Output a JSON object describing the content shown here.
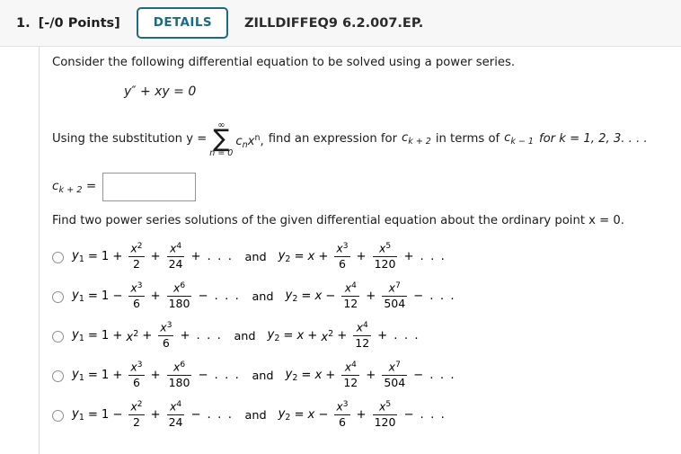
{
  "header": {
    "question_number": "1.",
    "points": "[-/0 Points]",
    "details_label": "DETAILS",
    "question_code": "ZILLDIFFEQ9 6.2.007.EP."
  },
  "body": {
    "intro_text": "Consider the following differential equation to be solved using a power series.",
    "equation": "y″ + xy = 0",
    "substitution": {
      "prefix": "Using the substitution y =",
      "sum_upper": "∞",
      "sum_symbol": "∑",
      "sum_lower": "n = 0",
      "summand_c": "c",
      "summand_c_sub": "n",
      "summand_x": "x",
      "summand_x_sup": "n",
      "comma": ",",
      "mid_text": "find an expression for",
      "target_c": "c",
      "target_sub": "k + 2",
      "in_terms_text": "in terms of",
      "source_c": "c",
      "source_sub": "k − 1",
      "for_text": "for k = 1, 2, 3. . . ."
    },
    "answer": {
      "label_c": "c",
      "label_sub": "k + 2",
      "label_eq": "=",
      "value": "",
      "placeholder": ""
    },
    "find_text": "Find two power series solutions of the given differential equation about the ordinary point x = 0.",
    "and_label": "and",
    "ellipsis": ". . .",
    "options": [
      {
        "y1": {
          "name": "y",
          "sub": "1",
          "eq": "=",
          "first": "1",
          "terms": [
            {
              "op": "+",
              "num_base": "x",
              "num_sup": "2",
              "den": "2"
            },
            {
              "op": "+",
              "num_base": "x",
              "num_sup": "4",
              "den": "24"
            }
          ],
          "tail_op": "+"
        },
        "y2": {
          "name": "y",
          "sub": "2",
          "eq": "=",
          "first": "x",
          "terms": [
            {
              "op": "+",
              "num_base": "x",
              "num_sup": "3",
              "den": "6"
            },
            {
              "op": "+",
              "num_base": "x",
              "num_sup": "5",
              "den": "120"
            }
          ],
          "tail_op": "+"
        }
      },
      {
        "y1": {
          "name": "y",
          "sub": "1",
          "eq": "=",
          "first": "1",
          "terms": [
            {
              "op": "−",
              "num_base": "x",
              "num_sup": "3",
              "den": "6"
            },
            {
              "op": "+",
              "num_base": "x",
              "num_sup": "6",
              "den": "180"
            }
          ],
          "tail_op": "−"
        },
        "y2": {
          "name": "y",
          "sub": "2",
          "eq": "=",
          "first": "x",
          "terms": [
            {
              "op": "−",
              "num_base": "x",
              "num_sup": "4",
              "den": "12"
            },
            {
              "op": "+",
              "num_base": "x",
              "num_sup": "7",
              "den": "504"
            }
          ],
          "tail_op": "−"
        }
      },
      {
        "y1": {
          "name": "y",
          "sub": "1",
          "eq": "=",
          "first": "1",
          "inline": {
            "op": "+",
            "base": "x",
            "sup": "2"
          },
          "terms": [
            {
              "op": "+",
              "num_base": "x",
              "num_sup": "3",
              "den": "6"
            }
          ],
          "tail_op": "+"
        },
        "y2": {
          "name": "y",
          "sub": "2",
          "eq": "=",
          "first": "x",
          "inline": {
            "op": "+",
            "base": "x",
            "sup": "2"
          },
          "terms": [
            {
              "op": "+",
              "num_base": "x",
              "num_sup": "4",
              "den": "12"
            }
          ],
          "tail_op": "+"
        }
      },
      {
        "y1": {
          "name": "y",
          "sub": "1",
          "eq": "=",
          "first": "1",
          "terms": [
            {
              "op": "+",
              "num_base": "x",
              "num_sup": "3",
              "den": "6"
            },
            {
              "op": "+",
              "num_base": "x",
              "num_sup": "6",
              "den": "180"
            }
          ],
          "tail_op": "−"
        },
        "y2": {
          "name": "y",
          "sub": "2",
          "eq": "=",
          "first": "x",
          "terms": [
            {
              "op": "+",
              "num_base": "x",
              "num_sup": "4",
              "den": "12"
            },
            {
              "op": "+",
              "num_base": "x",
              "num_sup": "7",
              "den": "504"
            }
          ],
          "tail_op": "−"
        }
      },
      {
        "y1": {
          "name": "y",
          "sub": "1",
          "eq": "=",
          "first": "1",
          "terms": [
            {
              "op": "−",
              "num_base": "x",
              "num_sup": "2",
              "den": "2"
            },
            {
              "op": "+",
              "num_base": "x",
              "num_sup": "4",
              "den": "24"
            }
          ],
          "tail_op": "−"
        },
        "y2": {
          "name": "y",
          "sub": "2",
          "eq": "=",
          "first": "x",
          "terms": [
            {
              "op": "−",
              "num_base": "x",
              "num_sup": "3",
              "den": "6"
            },
            {
              "op": "+",
              "num_base": "x",
              "num_sup": "5",
              "den": "120"
            }
          ],
          "tail_op": "−"
        }
      }
    ]
  },
  "colors": {
    "accent": "#1d6b82",
    "header_bg": "#f7f7f8",
    "text": "#1a1a1a",
    "border": "#d8d8d8"
  }
}
